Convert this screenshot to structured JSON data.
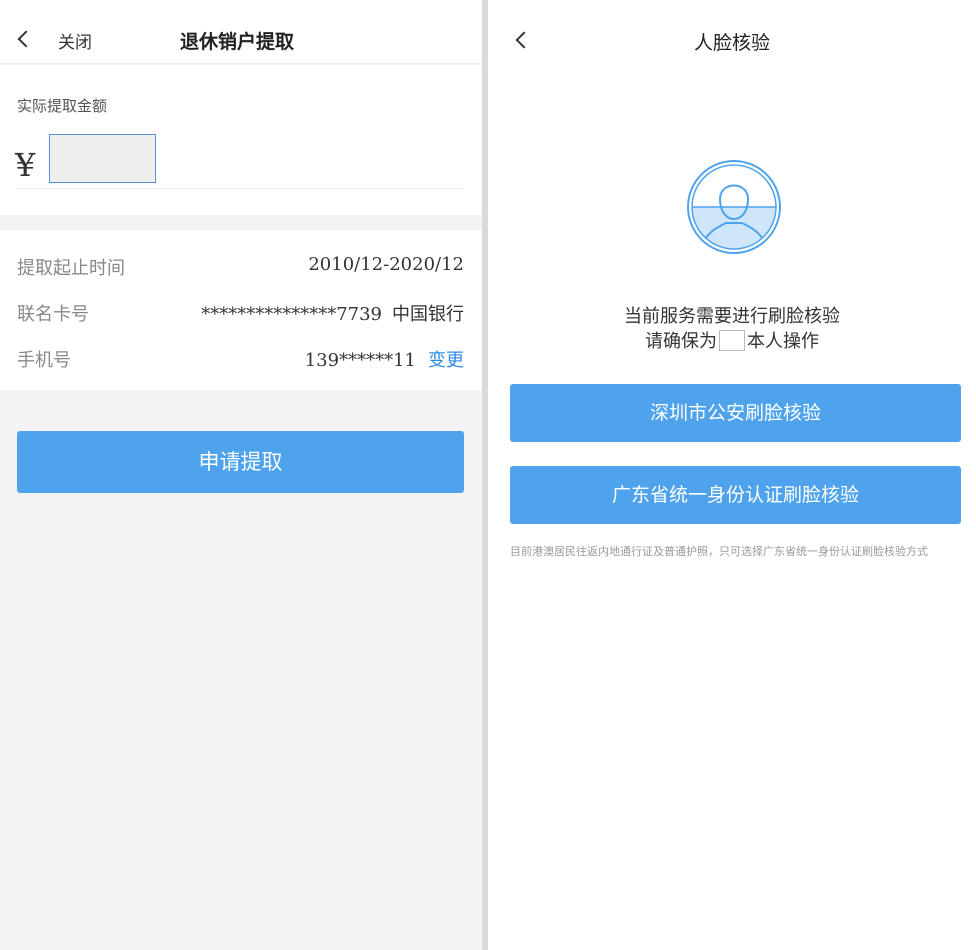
{
  "left": {
    "header": {
      "close_label": "关闭",
      "title": "退休销户提取"
    },
    "amount": {
      "label": "实际提取金额",
      "currency_symbol": "¥",
      "input_value": ""
    },
    "info": [
      {
        "label": "提取起止时间",
        "value": "2010/12-2020/12"
      },
      {
        "label": "联名卡号",
        "value": "***************7739",
        "bank": "中国银行"
      },
      {
        "label": "手机号",
        "value": "139******11",
        "action": "变更"
      }
    ],
    "apply_button": "申请提取"
  },
  "right": {
    "header": {
      "title": "人脸核验"
    },
    "message_line1": "当前服务需要进行刷脸核验",
    "message_line2_prefix": "请确保为",
    "message_line2_suffix": "本人操作",
    "buttons": [
      {
        "label": "深圳市公安刷脸核验"
      },
      {
        "label": "广东省统一身份认证刷脸核验"
      }
    ],
    "note": "目前港澳居民往返内地通行证及普通护照，只可选择广东省统一身份认证刷脸核验方式"
  },
  "colors": {
    "accent": "#4ea3ec",
    "link": "#2f8ce6",
    "face_icon": "#4ea3ec"
  }
}
